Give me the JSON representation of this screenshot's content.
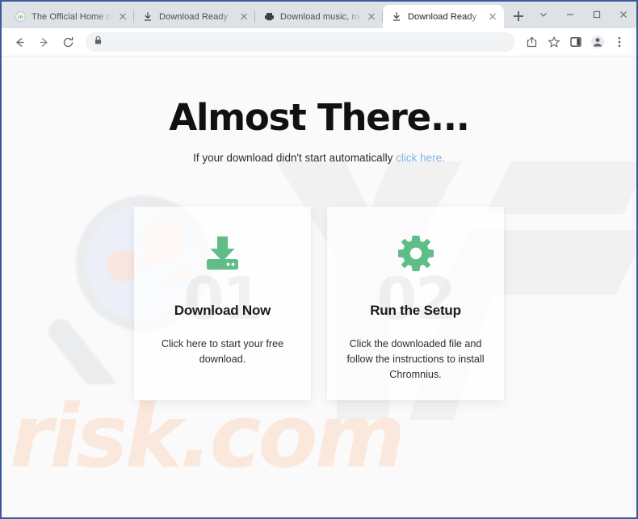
{
  "browser": {
    "tabs": [
      {
        "title": "The Official Home of YIFY",
        "favicon": "yify-icon",
        "active": false
      },
      {
        "title": "Download Ready",
        "favicon": "download-icon",
        "active": false
      },
      {
        "title": "Download music, movies,",
        "favicon": "printer-icon",
        "active": false
      },
      {
        "title": "Download Ready",
        "favicon": "download-icon",
        "active": true
      }
    ],
    "new_tab_label": "+",
    "window_controls": {
      "tab_search": "chevron-down-icon",
      "minimize": "minimize-icon",
      "maximize": "maximize-icon",
      "close": "close-icon"
    },
    "toolbar": {
      "back": "back-arrow-icon",
      "forward": "forward-arrow-icon",
      "reload": "reload-icon",
      "site_info": "lock-icon",
      "url": "",
      "url_placeholder": "",
      "share": "share-icon",
      "bookmark": "star-icon",
      "side_panel": "side-panel-icon",
      "profile": "profile-avatar-icon",
      "menu": "three-dot-menu-icon"
    }
  },
  "page": {
    "headline": "Almost There...",
    "subline_text": "If your download didn't start automatically ",
    "subline_link": "click here.",
    "watermark_brand": "risk.com",
    "cards": [
      {
        "number": "01",
        "icon": "download-tray-icon",
        "title": "Download Now",
        "description": "Click here to start your free download."
      },
      {
        "number": "02",
        "icon": "gear-icon",
        "title": "Run the Setup",
        "description": "Click the downloaded file and follow the instructions to install Chromnius."
      }
    ]
  },
  "colors": {
    "accent_green": "#5fbd85",
    "link_blue": "#7db2e2",
    "window_border": "#3b5a9a",
    "page_background": "#fafafa",
    "watermark_peach": "#fbe8dd"
  }
}
